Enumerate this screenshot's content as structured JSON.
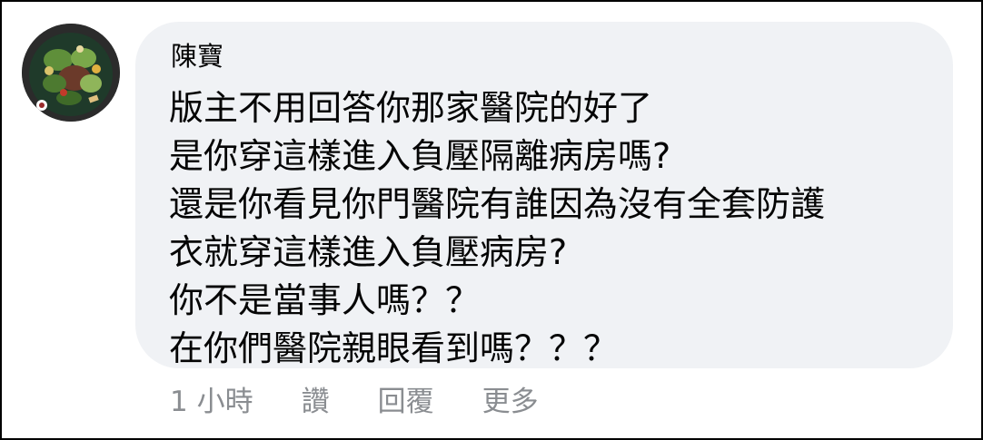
{
  "comment": {
    "author": "陳寶",
    "avatar_icon": "avatar-food-photo",
    "lines": [
      "版主不用回答你那家醫院的好了",
      "是你穿這樣進入負壓隔離病房嗎?",
      "還是你看見你門醫院有誰因為沒有全套防護",
      "衣就穿這樣進入負壓病房?",
      "你不是當事人嗎？？",
      "在你們醫院親眼看到嗎？？？"
    ],
    "timestamp": "1 小時",
    "actions": {
      "like": "讚",
      "reply": "回覆",
      "more": "更多"
    }
  },
  "colors": {
    "bubble_bg": "#f0f2f5",
    "text": "#050505",
    "meta": "#8a8d91"
  }
}
